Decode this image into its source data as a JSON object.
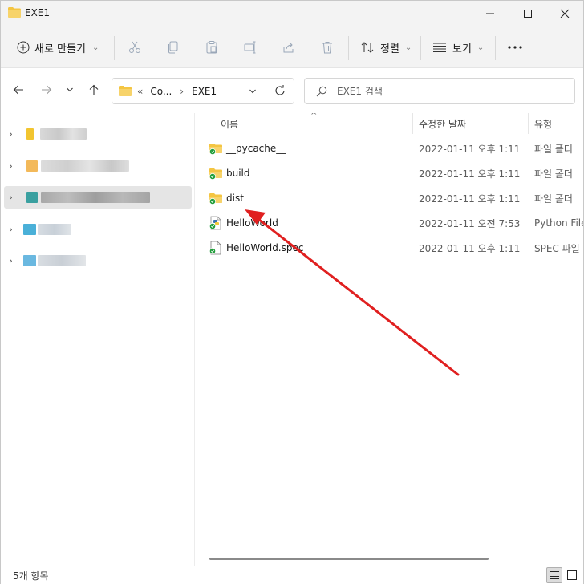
{
  "window": {
    "title": "EXE1",
    "folder_color": "#f4c542"
  },
  "toolbar": {
    "new_label": "새로 만들기",
    "sort_label": "정렬",
    "view_label": "보기",
    "more_label": "...",
    "icons": [
      "cut-icon",
      "copy-icon",
      "paste-icon",
      "rename-icon",
      "share-icon",
      "delete-icon"
    ]
  },
  "address": {
    "overflow": "«",
    "crumb1": "Co...",
    "crumb2": "EXE1",
    "sep": "›"
  },
  "search": {
    "placeholder": "EXE1 검색"
  },
  "sidebar": {
    "items": [
      {
        "state": "collapsed"
      },
      {
        "state": "collapsed"
      },
      {
        "state": "collapsed",
        "selected": true
      },
      {
        "state": "collapsed"
      },
      {
        "state": "collapsed"
      }
    ]
  },
  "columns": {
    "name": "이름",
    "date": "수정한 날짜",
    "type": "유형"
  },
  "files": [
    {
      "name": "__pycache__",
      "date": "2022-01-11 오후 1:11",
      "type": "파일 폴더",
      "kind": "folder"
    },
    {
      "name": "build",
      "date": "2022-01-11 오후 1:11",
      "type": "파일 폴더",
      "kind": "folder"
    },
    {
      "name": "dist",
      "date": "2022-01-11 오후 1:11",
      "type": "파일 폴더",
      "kind": "folder"
    },
    {
      "name": "HelloWorld",
      "date": "2022-01-11 오전 7:53",
      "type": "Python File",
      "kind": "python"
    },
    {
      "name": "HelloWorld.spec",
      "date": "2022-01-11 오후 1:11",
      "type": "SPEC 파일",
      "kind": "file"
    }
  ],
  "status": {
    "count": "5개 항목"
  },
  "annotation": {
    "color": "#e02020"
  }
}
